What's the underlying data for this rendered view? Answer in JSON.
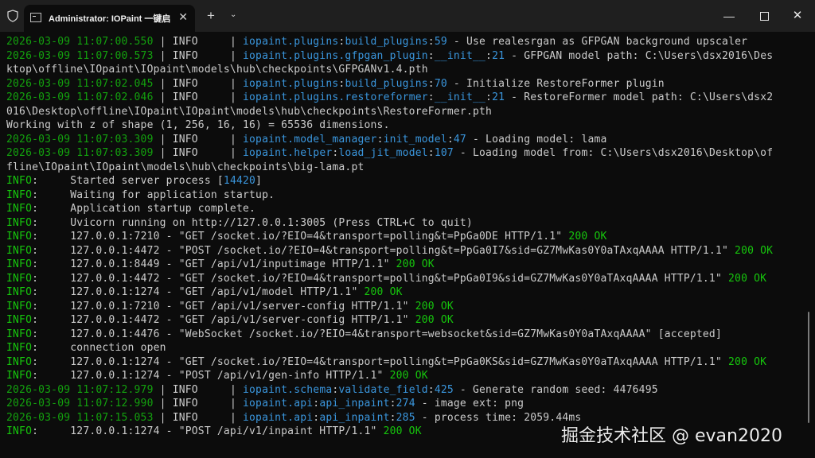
{
  "window": {
    "tab_title": "Administrator: IOPaint 一键启",
    "tab_close": "✕",
    "new_tab": "+",
    "dropdown": "⌄",
    "minimize": "—",
    "close": "✕"
  },
  "colors": {
    "background": "#0c0c0c",
    "timestamp_green": "#13a10e",
    "module_blue": "#3a96dd",
    "status_green": "#16c60c",
    "text": "#cccccc"
  },
  "terminal_lines": [
    [
      [
        "g",
        "2026-03-09 11:07:00.550"
      ],
      [
        "w",
        " | INFO     | "
      ],
      [
        "c",
        "iopaint.plugins"
      ],
      [
        "w",
        ":"
      ],
      [
        "c",
        "build_plugins"
      ],
      [
        "w",
        ":"
      ],
      [
        "c",
        "59"
      ],
      [
        "w",
        " - Use realesrgan as GFPGAN background upscaler"
      ]
    ],
    [
      [
        "g",
        "2026-03-09 11:07:00.573"
      ],
      [
        "w",
        " | INFO     | "
      ],
      [
        "c",
        "iopaint.plugins.gfpgan_plugin"
      ],
      [
        "w",
        ":"
      ],
      [
        "c",
        "__init__"
      ],
      [
        "w",
        ":"
      ],
      [
        "c",
        "21"
      ],
      [
        "w",
        " - GFPGAN model path: C:\\Users\\dsx2016\\Des"
      ]
    ],
    [
      [
        "w",
        "ktop\\offline\\IOpaint\\IOpaint\\models\\hub\\checkpoints\\GFPGANv1.4.pth"
      ]
    ],
    [
      [
        "g",
        "2026-03-09 11:07:02.045"
      ],
      [
        "w",
        " | INFO     | "
      ],
      [
        "c",
        "iopaint.plugins"
      ],
      [
        "w",
        ":"
      ],
      [
        "c",
        "build_plugins"
      ],
      [
        "w",
        ":"
      ],
      [
        "c",
        "70"
      ],
      [
        "w",
        " - Initialize RestoreFormer plugin"
      ]
    ],
    [
      [
        "g",
        "2026-03-09 11:07:02.046"
      ],
      [
        "w",
        " | INFO     | "
      ],
      [
        "c",
        "iopaint.plugins.restoreformer"
      ],
      [
        "w",
        ":"
      ],
      [
        "c",
        "__init__"
      ],
      [
        "w",
        ":"
      ],
      [
        "c",
        "21"
      ],
      [
        "w",
        " - RestoreFormer model path: C:\\Users\\dsx2"
      ]
    ],
    [
      [
        "w",
        "016\\Desktop\\offline\\IOpaint\\IOpaint\\models\\hub\\checkpoints\\RestoreFormer.pth"
      ]
    ],
    [
      [
        "w",
        "Working with z of shape (1, 256, 16, 16) = 65536 dimensions."
      ]
    ],
    [
      [
        "g",
        "2026-03-09 11:07:03.309"
      ],
      [
        "w",
        " | INFO     | "
      ],
      [
        "c",
        "iopaint.model_manager"
      ],
      [
        "w",
        ":"
      ],
      [
        "c",
        "init_model"
      ],
      [
        "w",
        ":"
      ],
      [
        "c",
        "47"
      ],
      [
        "w",
        " - Loading model: lama"
      ]
    ],
    [
      [
        "g",
        "2026-03-09 11:07:03.309"
      ],
      [
        "w",
        " | INFO     | "
      ],
      [
        "c",
        "iopaint.helper"
      ],
      [
        "w",
        ":"
      ],
      [
        "c",
        "load_jit_model"
      ],
      [
        "w",
        ":"
      ],
      [
        "c",
        "107"
      ],
      [
        "w",
        " - Loading model from: C:\\Users\\dsx2016\\Desktop\\of"
      ]
    ],
    [
      [
        "w",
        "fline\\IOpaint\\IOpaint\\models\\hub\\checkpoints\\big-lama.pt"
      ]
    ],
    [
      [
        "bg",
        "INFO"
      ],
      [
        "w",
        ":     Started server process ["
      ],
      [
        "c",
        "14420"
      ],
      [
        "w",
        "]"
      ]
    ],
    [
      [
        "bg",
        "INFO"
      ],
      [
        "w",
        ":     Waiting for application startup."
      ]
    ],
    [
      [
        "bg",
        "INFO"
      ],
      [
        "w",
        ":     Application startup complete."
      ]
    ],
    [
      [
        "bg",
        "INFO"
      ],
      [
        "w",
        ":     Uvicorn running on http://127.0.0.1:3005 (Press CTRL+C to quit)"
      ]
    ],
    [
      [
        "bg",
        "INFO"
      ],
      [
        "w",
        ":     127.0.0.1:7210 - \"GET /socket.io/?EIO=4&transport=polling&t=PpGa0DE HTTP/1.1\" "
      ],
      [
        "bg",
        "200 OK"
      ]
    ],
    [
      [
        "bg",
        "INFO"
      ],
      [
        "w",
        ":     127.0.0.1:4472 - \"POST /socket.io/?EIO=4&transport=polling&t=PpGa0I7&sid=GZ7MwKas0Y0aTAxqAAAA HTTP/1.1\" "
      ],
      [
        "bg",
        "200 OK"
      ]
    ],
    [
      [
        "bg",
        "INFO"
      ],
      [
        "w",
        ":     127.0.0.1:8449 - \"GET /api/v1/inputimage HTTP/1.1\" "
      ],
      [
        "bg",
        "200 OK"
      ]
    ],
    [
      [
        "bg",
        "INFO"
      ],
      [
        "w",
        ":     127.0.0.1:4472 - \"GET /socket.io/?EIO=4&transport=polling&t=PpGa0I9&sid=GZ7MwKas0Y0aTAxqAAAA HTTP/1.1\" "
      ],
      [
        "bg",
        "200 OK"
      ]
    ],
    [
      [
        "bg",
        "INFO"
      ],
      [
        "w",
        ":     127.0.0.1:1274 - \"GET /api/v1/model HTTP/1.1\" "
      ],
      [
        "bg",
        "200 OK"
      ]
    ],
    [
      [
        "bg",
        "INFO"
      ],
      [
        "w",
        ":     127.0.0.1:7210 - \"GET /api/v1/server-config HTTP/1.1\" "
      ],
      [
        "bg",
        "200 OK"
      ]
    ],
    [
      [
        "bg",
        "INFO"
      ],
      [
        "w",
        ":     127.0.0.1:4472 - \"GET /api/v1/server-config HTTP/1.1\" "
      ],
      [
        "bg",
        "200 OK"
      ]
    ],
    [
      [
        "bg",
        "INFO"
      ],
      [
        "w",
        ":     127.0.0.1:4476 - \"WebSocket /socket.io/?EIO=4&transport=websocket&sid=GZ7MwKas0Y0aTAxqAAAA\" [accepted]"
      ]
    ],
    [
      [
        "bg",
        "INFO"
      ],
      [
        "w",
        ":     connection open"
      ]
    ],
    [
      [
        "bg",
        "INFO"
      ],
      [
        "w",
        ":     127.0.0.1:1274 - \"GET /socket.io/?EIO=4&transport=polling&t=PpGa0KS&sid=GZ7MwKas0Y0aTAxqAAAA HTTP/1.1\" "
      ],
      [
        "bg",
        "200 OK"
      ]
    ],
    [
      [
        "bg",
        "INFO"
      ],
      [
        "w",
        ":     127.0.0.1:1274 - \"POST /api/v1/gen-info HTTP/1.1\" "
      ],
      [
        "bg",
        "200 OK"
      ]
    ],
    [
      [
        "g",
        "2026-03-09 11:07:12.979"
      ],
      [
        "w",
        " | INFO     | "
      ],
      [
        "c",
        "iopaint.schema"
      ],
      [
        "w",
        ":"
      ],
      [
        "c",
        "validate_field"
      ],
      [
        "w",
        ":"
      ],
      [
        "c",
        "425"
      ],
      [
        "w",
        " - Generate random seed: 4476495"
      ]
    ],
    [
      [
        "g",
        "2026-03-09 11:07:12.990"
      ],
      [
        "w",
        " | INFO     | "
      ],
      [
        "c",
        "iopaint.api"
      ],
      [
        "w",
        ":"
      ],
      [
        "c",
        "api_inpaint"
      ],
      [
        "w",
        ":"
      ],
      [
        "c",
        "274"
      ],
      [
        "w",
        " - image ext: png"
      ]
    ],
    [
      [
        "g",
        "2026-03-09 11:07:15.053"
      ],
      [
        "w",
        " | INFO     | "
      ],
      [
        "c",
        "iopaint.api"
      ],
      [
        "w",
        ":"
      ],
      [
        "c",
        "api_inpaint"
      ],
      [
        "w",
        ":"
      ],
      [
        "c",
        "285"
      ],
      [
        "w",
        " - process time: 2059.44ms"
      ]
    ],
    [
      [
        "bg",
        "INFO"
      ],
      [
        "w",
        ":     127.0.0.1:1274 - \"POST /api/v1/inpaint HTTP/1.1\" "
      ],
      [
        "bg",
        "200 OK"
      ]
    ]
  ],
  "watermark": "掘金技术社区 @ evan2020"
}
